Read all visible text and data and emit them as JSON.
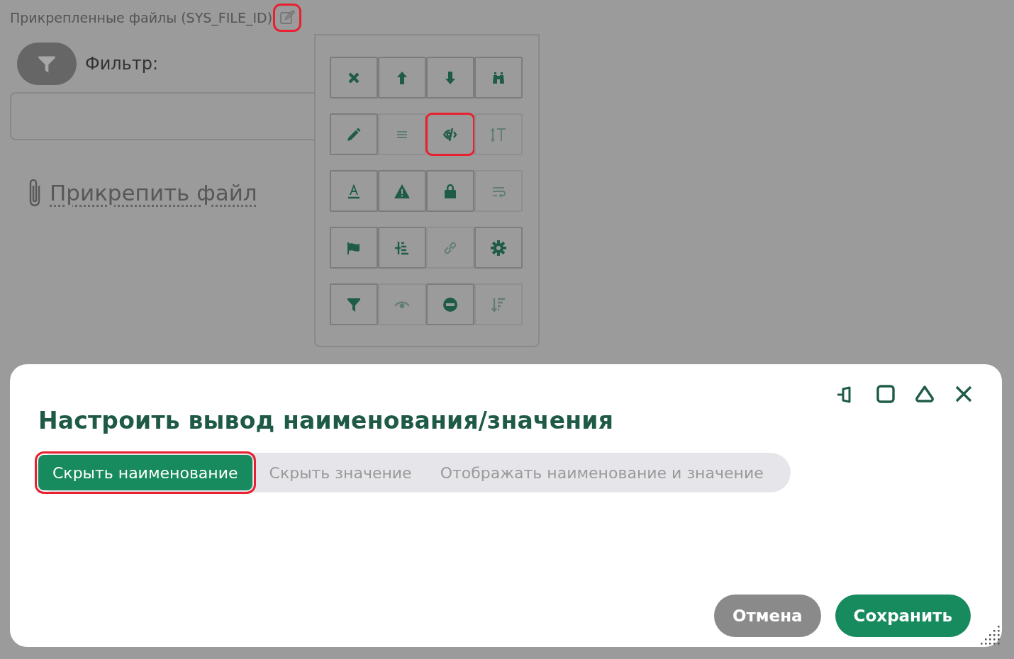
{
  "page": {
    "field_label": "Прикрепленные файлы (SYS_FILE_ID)",
    "edit_highlighted": true,
    "filter_label": "Фильтр:",
    "attach_link": "Прикрепить файл"
  },
  "tools": [
    {
      "disabled": false,
      "highlighted": false
    },
    {
      "disabled": false,
      "highlighted": false
    },
    {
      "disabled": false,
      "highlighted": false
    },
    {
      "disabled": false,
      "highlighted": false
    },
    {
      "disabled": false,
      "highlighted": false
    },
    {
      "disabled": true,
      "highlighted": false
    },
    {
      "disabled": false,
      "highlighted": true
    },
    {
      "disabled": true,
      "highlighted": false
    },
    {
      "disabled": false,
      "highlighted": false
    },
    {
      "disabled": false,
      "highlighted": false
    },
    {
      "disabled": false,
      "highlighted": false
    },
    {
      "disabled": true,
      "highlighted": false
    },
    {
      "disabled": false,
      "highlighted": false
    },
    {
      "disabled": false,
      "highlighted": false
    },
    {
      "disabled": true,
      "highlighted": false
    },
    {
      "disabled": false,
      "highlighted": false
    },
    {
      "disabled": false,
      "highlighted": false
    },
    {
      "disabled": true,
      "highlighted": false
    },
    {
      "disabled": false,
      "highlighted": false
    },
    {
      "disabled": true,
      "highlighted": false
    }
  ],
  "dialog": {
    "title": "Настроить вывод наименования/значения",
    "options": [
      {
        "label": "Скрыть наименование",
        "selected": true,
        "highlighted": true
      },
      {
        "label": "Скрыть значение",
        "selected": false,
        "highlighted": false
      },
      {
        "label": "Отображать наименование и значение",
        "selected": false,
        "highlighted": false
      }
    ],
    "buttons": [
      {
        "label": "Отмена",
        "kind": "secondary"
      },
      {
        "label": "Сохранить",
        "kind": "primary"
      }
    ]
  }
}
